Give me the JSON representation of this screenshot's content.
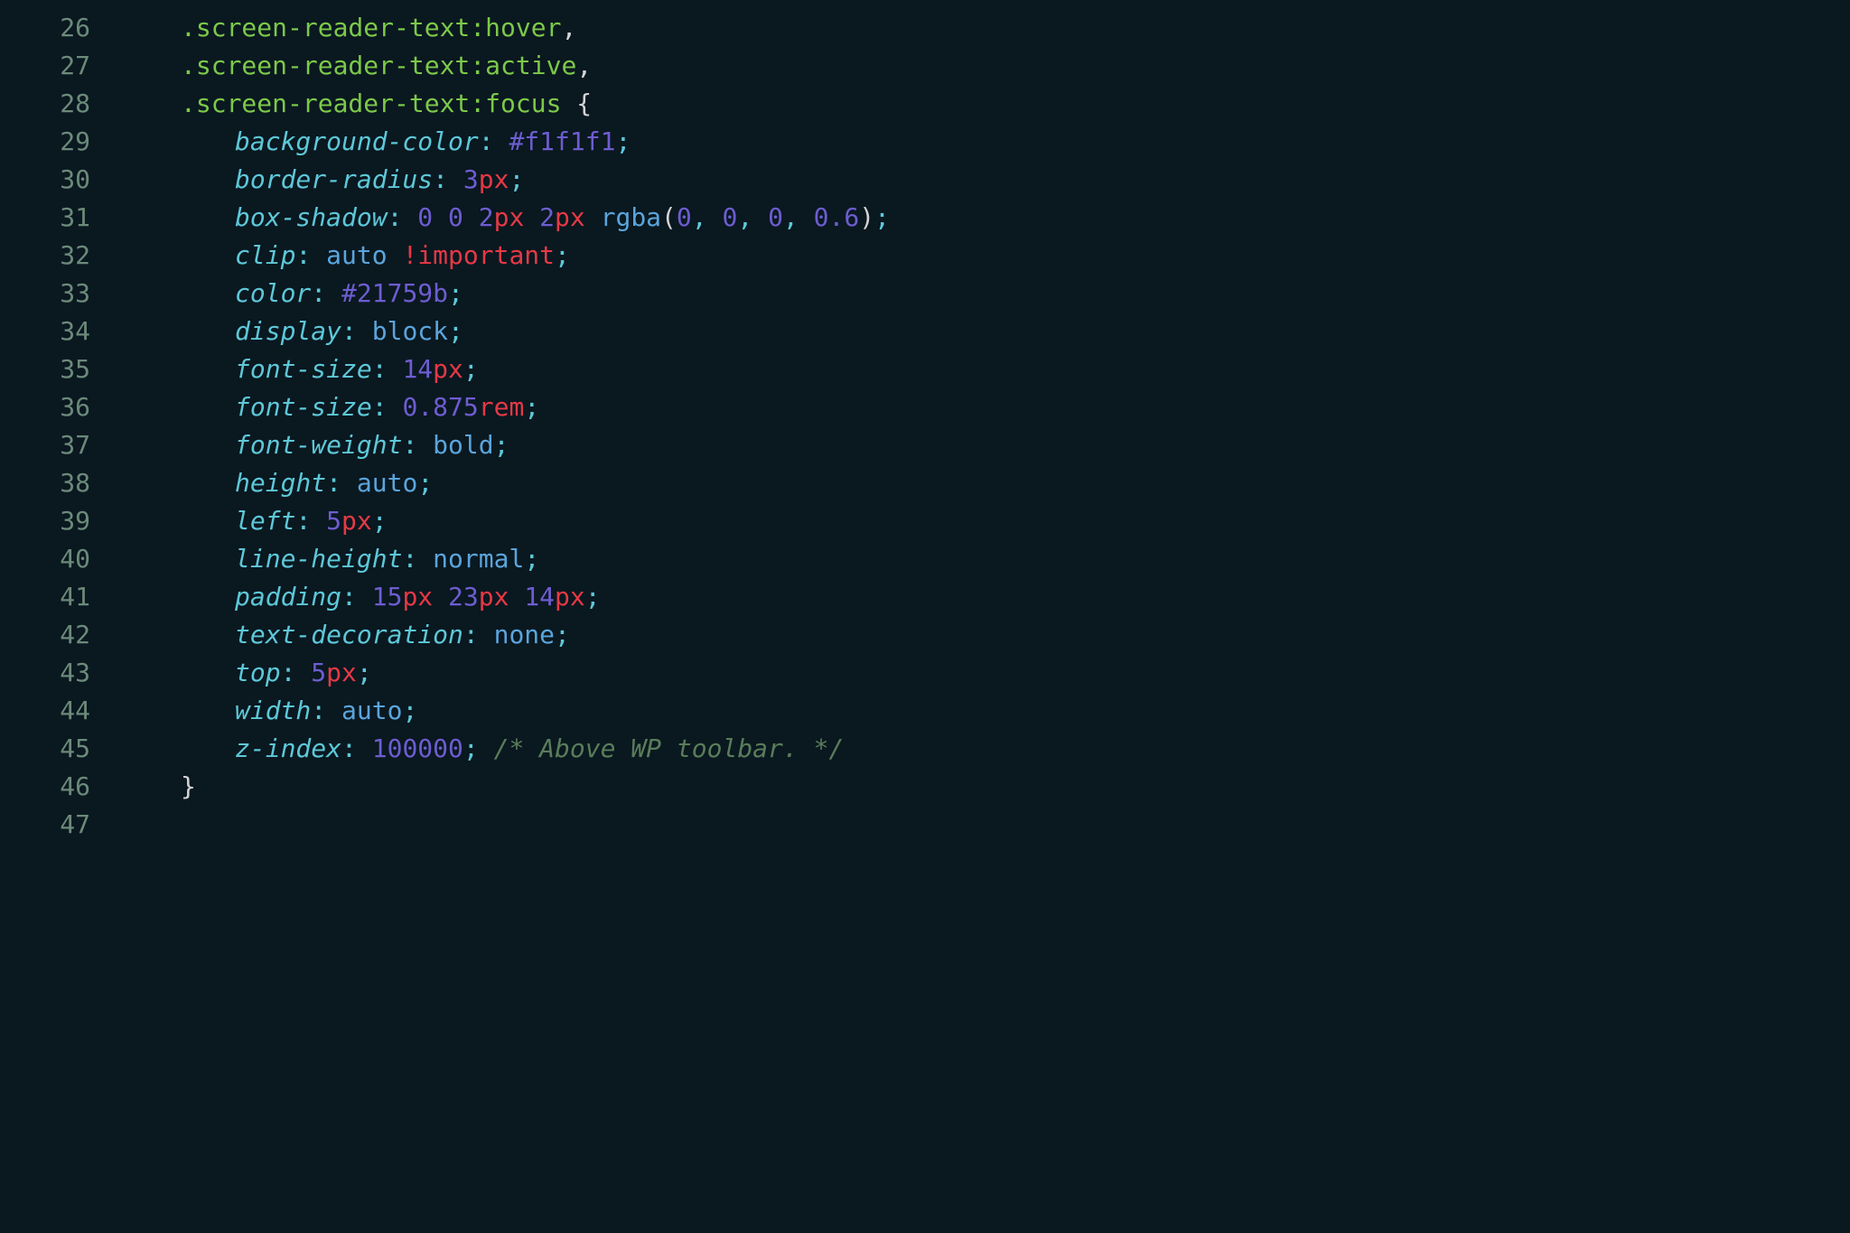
{
  "lines": {
    "26": {
      "num": "26",
      "selector": ".screen-reader-text",
      "pseudo": ":hover",
      "after": ","
    },
    "27": {
      "num": "27",
      "selector": ".screen-reader-text",
      "pseudo": ":active",
      "after": ","
    },
    "28": {
      "num": "28",
      "selector": ".screen-reader-text",
      "pseudo": ":focus",
      "brace": " {"
    },
    "29": {
      "num": "29",
      "prop": "background-color",
      "hex": "#f1f1f1"
    },
    "30": {
      "num": "30",
      "prop": "border-radius",
      "num_val": "3",
      "unit": "px"
    },
    "31": {
      "num": "31",
      "prop": "box-shadow",
      "n1": "0",
      "sp1": " ",
      "n2": "0",
      "sp2": " ",
      "n3": "2",
      "u3": "px",
      "sp3": " ",
      "n4": "2",
      "u4": "px",
      "sp4": " ",
      "func": "rgba",
      "a1": "0",
      "c1": ", ",
      "a2": "0",
      "c2": ", ",
      "a3": "0",
      "c3": ", ",
      "a4": "0.6",
      "rp": ")"
    },
    "32": {
      "num": "32",
      "prop": "clip",
      "val": "auto",
      "imp": " !important"
    },
    "33": {
      "num": "33",
      "prop": "color",
      "hex": "#21759b"
    },
    "34": {
      "num": "34",
      "prop": "display",
      "val": "block"
    },
    "35": {
      "num": "35",
      "prop": "font-size",
      "num_val": "14",
      "unit": "px"
    },
    "36": {
      "num": "36",
      "prop": "font-size",
      "num_val": "0.875",
      "unit": "rem"
    },
    "37": {
      "num": "37",
      "prop": "font-weight",
      "val": "bold"
    },
    "38": {
      "num": "38",
      "prop": "height",
      "val": "auto"
    },
    "39": {
      "num": "39",
      "prop": "left",
      "num_val": "5",
      "unit": "px"
    },
    "40": {
      "num": "40",
      "prop": "line-height",
      "val": "normal"
    },
    "41": {
      "num": "41",
      "prop": "padding",
      "n1": "15",
      "u1": "px",
      "sp1": " ",
      "n2": "23",
      "u2": "px",
      "sp2": " ",
      "n3": "14",
      "u3": "px"
    },
    "42": {
      "num": "42",
      "prop": "text-decoration",
      "val": "none"
    },
    "43": {
      "num": "43",
      "prop": "top",
      "num_val": "5",
      "unit": "px"
    },
    "44": {
      "num": "44",
      "prop": "width",
      "val": "auto"
    },
    "45": {
      "num": "45",
      "prop": "z-index",
      "num_val": "100000",
      "comment": " /* Above WP toolbar. */"
    },
    "46": {
      "num": "46",
      "brace": "}"
    },
    "47": {
      "num": "47"
    }
  },
  "punct": {
    "colon": ":",
    "semi": ";",
    "sp": " ",
    "lp": "("
  }
}
